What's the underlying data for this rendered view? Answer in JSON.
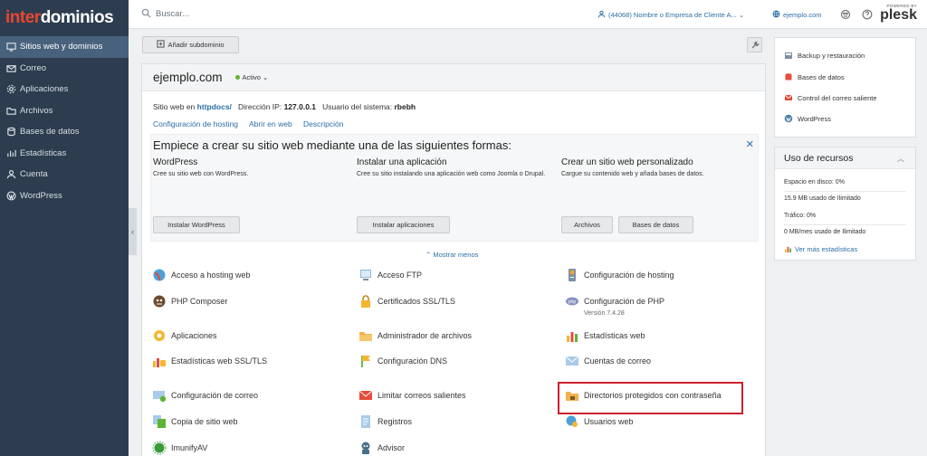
{
  "brand": {
    "part1": "inter",
    "part2": "dominios"
  },
  "sidebar": {
    "items": [
      {
        "label": "Sitios web y dominios",
        "icon": "monitor-icon"
      },
      {
        "label": "Correo",
        "icon": "mail-icon"
      },
      {
        "label": "Aplicaciones",
        "icon": "gear-icon"
      },
      {
        "label": "Archivos",
        "icon": "folder-icon"
      },
      {
        "label": "Bases de datos",
        "icon": "database-icon"
      },
      {
        "label": "Estadísticas",
        "icon": "chart-icon"
      },
      {
        "label": "Cuenta",
        "icon": "user-icon"
      },
      {
        "label": "WordPress",
        "icon": "wordpress-icon"
      }
    ],
    "collapse_glyph": "‹"
  },
  "topbar": {
    "search_placeholder": "Buscar...",
    "account": "(44068) Nombre o Empresa de Cliente A... ⌄",
    "domain": "ejemplo.com",
    "plesk_powered": "POWERED BY",
    "plesk_word": "plesk"
  },
  "main": {
    "add_subdomain": "Añadir subdominio",
    "domain_name": "ejemplo.com",
    "status": "Activo ⌄",
    "info": {
      "prefix": "Sitio web en ",
      "docroot": "httpdocs/",
      "ip_label": "Dirección IP: ",
      "ip": "127.0.0.1",
      "user_label": "Usuario del sistema: ",
      "user": "rbebh"
    },
    "links": [
      "Configuración de hosting",
      "Abrir en web",
      "Descripción"
    ],
    "start": {
      "title": "Empiece a crear su sitio web mediante una de las siguientes formas:",
      "close": "✕",
      "columns": [
        {
          "title": "WordPress",
          "desc": "Cree su sitio web con WordPress.",
          "buttons": [
            "Instalar WordPress"
          ]
        },
        {
          "title": "Instalar una aplicación",
          "desc": "Cree su sitio instalando una aplicación web como Joomla o Drupal.",
          "buttons": [
            "Instalar aplicaciones"
          ]
        },
        {
          "title": "Crear un sitio web personalizado",
          "desc": "Cargue su contenido web y añada bases de datos.",
          "buttons": [
            "Archivos",
            "Bases de datos"
          ]
        }
      ]
    },
    "show_less": "⌃ Mostrar menos",
    "tiles": [
      {
        "label": "Acceso a hosting web",
        "icon": "globe-icon"
      },
      {
        "label": "Acceso FTP",
        "icon": "ftp-icon"
      },
      {
        "label": "Configuración de hosting",
        "icon": "hosting-settings-icon"
      },
      {
        "label": "PHP Composer",
        "icon": "composer-icon"
      },
      {
        "label": "Certificados SSL/TLS",
        "icon": "lock-icon"
      },
      {
        "label": "Configuración de PHP",
        "icon": "php-icon",
        "sub": "Versión 7.4.28"
      },
      {
        "label": "Aplicaciones",
        "icon": "gear-icon"
      },
      {
        "label": "Administrador de archivos",
        "icon": "folder-icon"
      },
      {
        "label": "Estadísticas web",
        "icon": "bar-chart-icon"
      },
      {
        "label": "Estadísticas web SSL/TLS",
        "icon": "ssl-stats-icon"
      },
      {
        "label": "Configuración DNS",
        "icon": "dns-icon"
      },
      {
        "label": "Cuentas de correo",
        "icon": "mail-icon"
      },
      {
        "label": "Configuración de correo",
        "icon": "mail-settings-icon"
      },
      {
        "label": "Limitar correos salientes",
        "icon": "mail-limit-icon"
      },
      {
        "label": "Directorios protegidos con contraseña",
        "icon": "protected-folder-icon"
      },
      {
        "label": "Copia de sitio web",
        "icon": "copy-icon"
      },
      {
        "label": "Registros",
        "icon": "logs-icon"
      },
      {
        "label": "Usuarios web",
        "icon": "web-users-icon"
      },
      {
        "label": "ImunifyAV",
        "icon": "imunify-icon"
      },
      {
        "label": "Advisor",
        "icon": "advisor-icon"
      }
    ]
  },
  "right": {
    "quick_links": [
      {
        "label": "Backup y restauración",
        "icon": "backup-icon"
      },
      {
        "label": "Bases de datos",
        "icon": "database-icon"
      },
      {
        "label": "Control del correo saliente",
        "icon": "mail-control-icon"
      },
      {
        "label": "WordPress",
        "icon": "wordpress-icon"
      }
    ],
    "usage": {
      "title": "Uso de recursos",
      "disk_label": "Espacio en disco: 0%",
      "disk_detail": "15.9 MB usado de Ilimitado",
      "traffic_label": "Tráfico: 0%",
      "traffic_detail": "0 MB/mes usado de Ilimitado",
      "more_link": "Ver más estadísticas"
    }
  },
  "colors": {
    "sidebar_bg": "#2d3d4f",
    "sidebar_active": "#48627d",
    "link_blue": "#2c6ea8",
    "brand_red": "#e8462f",
    "highlight_red": "#cd2030",
    "status_green": "#5fb336"
  }
}
